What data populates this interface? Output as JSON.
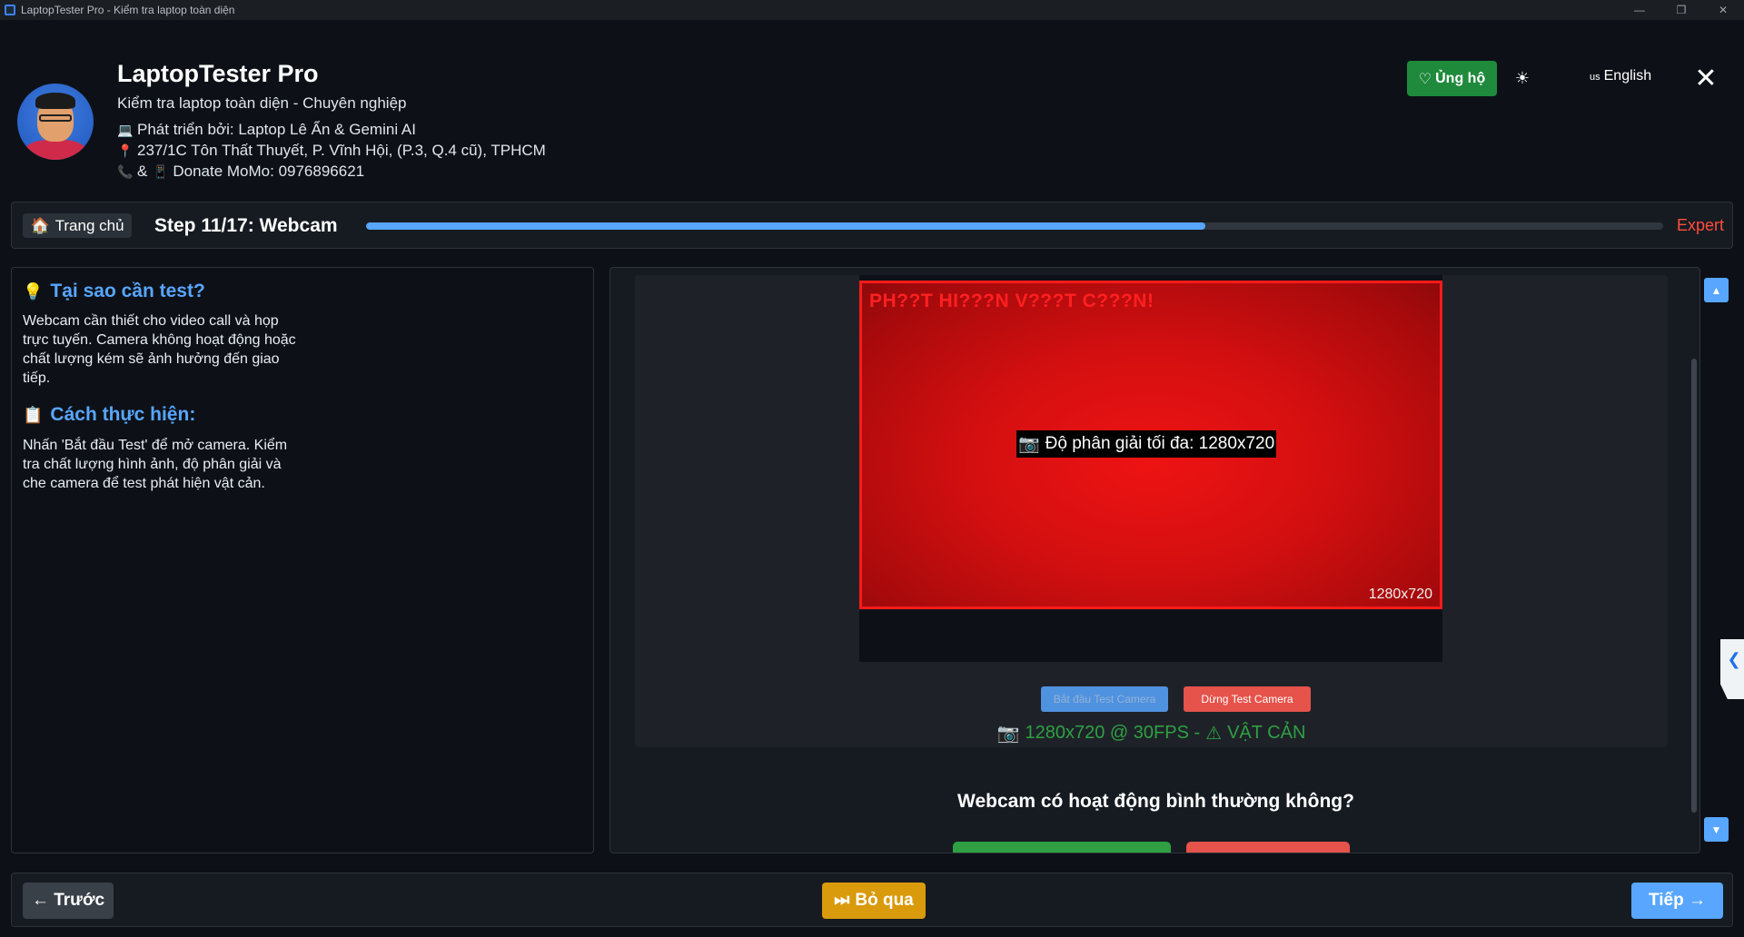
{
  "window": {
    "title": "LaptopTester Pro - Kiểm tra laptop toàn diện",
    "minimize": "—",
    "maximize": "❐",
    "close": "✕"
  },
  "header": {
    "app_name": "LaptopTester Pro",
    "subtitle": "Kiểm tra laptop toàn diện - Chuyên nghiệp",
    "developer_icon": "💻",
    "developer": "Phát triển bởi: Laptop Lê Ẩn & Gemini AI",
    "address_icon": "📍",
    "address": "237/1C Tôn Thất Thuyết, P. Vĩnh Hội, (P.3, Q.4 cũ), TPHCM",
    "phone_icon": "📞",
    "phone_sep": "&",
    "donate_icon": "📱",
    "donate": "Donate MoMo: 0976896621",
    "support_icon": "♡",
    "support_label": "Ủng hộ",
    "theme_icon": "☀",
    "lang_flag": "us",
    "lang_label": "English",
    "close_icon": "✕"
  },
  "stepbar": {
    "home_icon": "🏠",
    "home_label": "Trang chủ",
    "step_title": "Step 11/17: Webcam",
    "progress": 0.647,
    "level": "Expert"
  },
  "info": {
    "why_icon": "💡",
    "why_title": "Tại sao cần test?",
    "why_text": "Webcam cần thiết cho video call và họp trực tuyến. Camera không hoạt động hoặc chất lượng kém sẽ ảnh hưởng đến giao tiếp.",
    "how_icon": "📋",
    "how_title": "Cách thực hiện:",
    "how_text": "Nhấn 'Bắt đầu Test' để mở camera. Kiểm tra chất lượng hình ảnh, độ phân giải và che camera để test phát hiện vật cản."
  },
  "camera": {
    "warning_overlay": "PH??T HI???N V???T C???N!",
    "res_icon": "📷",
    "res_label": "Độ phân giải tối đa: 1280x720",
    "res_corner": "1280x720",
    "start_label": "Bắt đầu Test Camera",
    "stop_label": "Dừng Test Camera",
    "status_icon": "📷",
    "status_text": "1280x720 @ 30FPS -",
    "warn_icon": "⚠",
    "warn_text": "VẬT CẢN",
    "colors": {
      "overlay_border": "#ff1a1a",
      "status": "#2ea043"
    }
  },
  "question": {
    "text": "Webcam có hoạt động bình thường không?"
  },
  "scroll": {
    "up_icon": "▲",
    "down_icon": "▼",
    "side_icon": "❮"
  },
  "footer": {
    "prev_label": "← Trước",
    "skip_icon": "⏭",
    "skip_label": "Bỏ qua",
    "next_label": "Tiếp →"
  }
}
